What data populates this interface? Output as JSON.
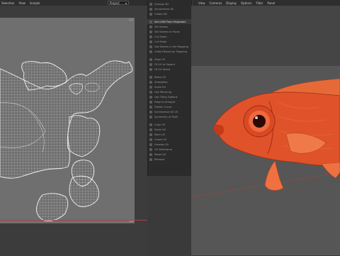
{
  "uv_header": {
    "menu": [
      "Selection",
      "View",
      "Sculpts"
    ],
    "mode_value": "Project",
    "corner_tl": "1,1",
    "corner_br": "1,0"
  },
  "tools": [
    {
      "label": "Unwrap 3D",
      "active": false
    },
    {
      "label": "Symmetrize All",
      "active": false
    },
    {
      "label": "Unfold 3D",
      "active": false
    },
    {
      "label": "",
      "active": false
    },
    {
      "label": "Set UVW From Projection",
      "active": true
    },
    {
      "label": "Set Seams",
      "active": false
    },
    {
      "label": "Set Seams on Faces",
      "active": false
    },
    {
      "label": "Cut Seam",
      "active": false
    },
    {
      "label": "Cut Mode",
      "active": false
    },
    {
      "label": "Use Seams in the Mapping",
      "active": false
    },
    {
      "label": "Unfold Based on Mapping",
      "active": false
    },
    {
      "label": "",
      "active": false
    },
    {
      "label": "Align UV",
      "active": false
    },
    {
      "label": "Fit UV to Square",
      "active": false
    },
    {
      "label": "Fit UV Island",
      "active": false
    },
    {
      "label": "",
      "active": false
    },
    {
      "label": "Relax UV",
      "active": false
    },
    {
      "label": "Straighten",
      "active": false
    },
    {
      "label": "Scale UV",
      "active": false
    },
    {
      "label": "Use Mirroring",
      "active": false
    },
    {
      "label": "Use Tiling Options",
      "active": false
    },
    {
      "label": "Edge to Straight",
      "active": false
    },
    {
      "label": "Flatten Curve",
      "active": false
    },
    {
      "label": "Symmetrize All UV",
      "active": false
    },
    {
      "label": "Symmetry of Shell",
      "active": false
    },
    {
      "label": "",
      "active": false
    },
    {
      "label": "Copy UV",
      "active": false
    },
    {
      "label": "Paste UV",
      "active": false
    },
    {
      "label": "Mark UV",
      "active": false
    },
    {
      "label": "Check UV",
      "active": false
    },
    {
      "label": "Unwrap UV",
      "active": false
    },
    {
      "label": "UV Wireframe",
      "active": false
    },
    {
      "label": "Reset UV",
      "active": false
    },
    {
      "label": "Remove",
      "active": false
    }
  ],
  "vp_header": {
    "menu": [
      "View",
      "Cameras",
      "Display",
      "Options",
      "Filter",
      "Panel"
    ]
  },
  "colors": {
    "uv_bg": "#6f6f6f",
    "wire": "#e8e8e8",
    "fish_body": "#e0532a",
    "fish_dark": "#a22d12",
    "panel": "#2b2b2b"
  }
}
